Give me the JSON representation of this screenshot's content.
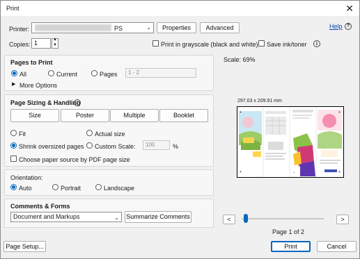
{
  "window": {
    "title": "Print",
    "close_glyph": "✕"
  },
  "header": {
    "printer_label": "Printer:",
    "printer_value": "PS",
    "properties_label": "Properties",
    "advanced_label": "Advanced",
    "help_label": "Help",
    "copies_label": "Copies:",
    "copies_value": "1",
    "grayscale_label": "Print in grayscale (black and white)",
    "save_ink_label": "Save ink/toner"
  },
  "pages_to_print": {
    "title": "Pages to Print",
    "all_label": "All",
    "current_label": "Current",
    "pages_label": "Pages",
    "pages_range": "1 - 2",
    "more_options_label": "More Options"
  },
  "page_sizing": {
    "title": "Page Sizing & Handling",
    "tabs": [
      "Size",
      "Poster",
      "Multiple",
      "Booklet"
    ],
    "fit_label": "Fit",
    "actual_size_label": "Actual size",
    "shrink_label": "Shrink oversized pages",
    "custom_scale_label": "Custom Scale:",
    "custom_scale_value": "100",
    "percent": "%",
    "paper_source_label": "Choose paper source by PDF page size"
  },
  "orientation": {
    "title": "Orientation:",
    "auto_label": "Auto",
    "portrait_label": "Portrait",
    "landscape_label": "Landscape"
  },
  "comments_forms": {
    "title": "Comments & Forms",
    "selected": "Document and Markups",
    "summarize_label": "Summarize Comments"
  },
  "preview": {
    "scale_label": "Scale:  69%",
    "dimensions": "297.03 x 209.91 mm",
    "page_indicator": "Page 1 of 2",
    "prev_glyph": "<",
    "next_glyph": ">",
    "slider_position": 0.05
  },
  "footer": {
    "page_setup_label": "Page Setup...",
    "print_label": "Print",
    "cancel_label": "Cancel"
  },
  "colors": {
    "accent": "#0067c0",
    "link": "#0645ad"
  }
}
